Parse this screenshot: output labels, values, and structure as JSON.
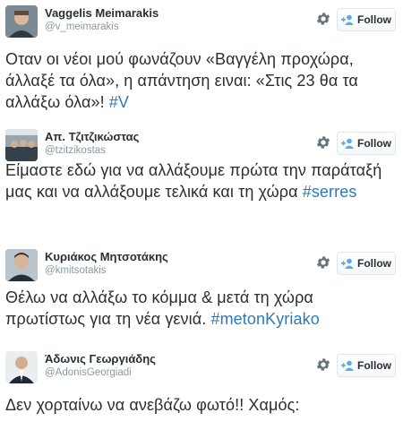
{
  "colors": {
    "link": "#2b7bb9",
    "text": "#292f33",
    "muted": "#8899a6",
    "follow_icon": "#55acee"
  },
  "follow_label": "Follow",
  "tweets": [
    {
      "name": "Vaggelis Meimarakis",
      "handle": "@v_meimarakis",
      "text": "Οταν οι νέοι μού φωνάζουν  «Βαγγέλη προχώρα, άλλαξέ τα όλα», η απάντηση ειναι: «Στις 23 θα τα αλλάξω όλα»! ",
      "hashtag": "#V"
    },
    {
      "name": "Απ. Τζιτζικώστας",
      "handle": "@tzitzikostas",
      "text": "Είμαστε εδώ για να αλλάξουμε πρώτα την παράταξή μας και να αλλάξουμε τελικά και τη χώρα ",
      "hashtag": "#serres"
    },
    {
      "name": "Κυριάκος Μητσοτάκης",
      "handle": "@kmitsotakis",
      "text": "Θέλω να αλλάξω το κόμμα & μετά τη χώρα πρωτίστως για τη νέα γενιά. ",
      "hashtag": "#metonKyriako"
    },
    {
      "name": "Άδωνις Γεωργιάδης",
      "handle": "@AdonisGeorgiadi",
      "text": "Δεν χορταίνω να ανεβάζω φωτό!! Χαμός:",
      "hashtag": ""
    }
  ]
}
